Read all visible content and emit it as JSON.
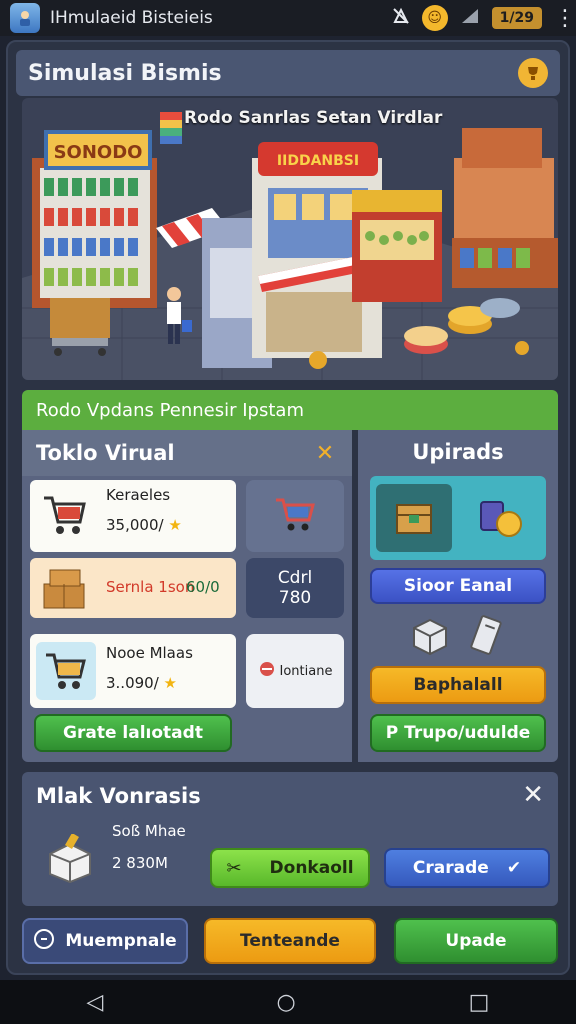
{
  "statusbar": {
    "app_title": "IHmulaeid Bisteieis",
    "battery_text": "1/29",
    "icons": [
      "app-icon",
      "signal-off-icon",
      "emoji-icon",
      "signal-icon",
      "battery-icon",
      "more-icon"
    ]
  },
  "header": {
    "title": "Simulasi Bismis"
  },
  "scene": {
    "caption": "Rodo Sanrlas Setan Virdlar",
    "sign1": "SONODO",
    "sign2": "IIDDANBSI"
  },
  "banner": {
    "text": "Rodo Vpdans Pennesir Ipstam"
  },
  "store": {
    "title": "Toklo Virual",
    "items": [
      {
        "title": "Keraeles",
        "price": "35,000/"
      },
      {
        "title": "Sernla 1son",
        "price": "60/0"
      },
      {
        "title": "Nooe Mlaas",
        "price": "3..090/"
      }
    ],
    "side1_line1": "Cdrl",
    "side1_line2": "780",
    "side2_label": "Iontiane",
    "bottom_button": "Grate lalıotadt"
  },
  "upgrades": {
    "title": "Upirads",
    "button1": "Sioor Eanal",
    "button2": "Baphalall",
    "button3": "P  Trupo/udulde"
  },
  "panel2": {
    "title": "Mlak Vonrasis",
    "label1": "Soß Mhae",
    "label2": "2 830M",
    "btn_left": "Donkaoll",
    "btn_right": "Crarade"
  },
  "actions": {
    "left": "Muempnale",
    "middle": "Tenteande",
    "right": "Upade"
  },
  "colors": {
    "accent_green": "#5cae3f",
    "accent_orange": "#f1b534",
    "accent_blue": "#3b52c4"
  }
}
